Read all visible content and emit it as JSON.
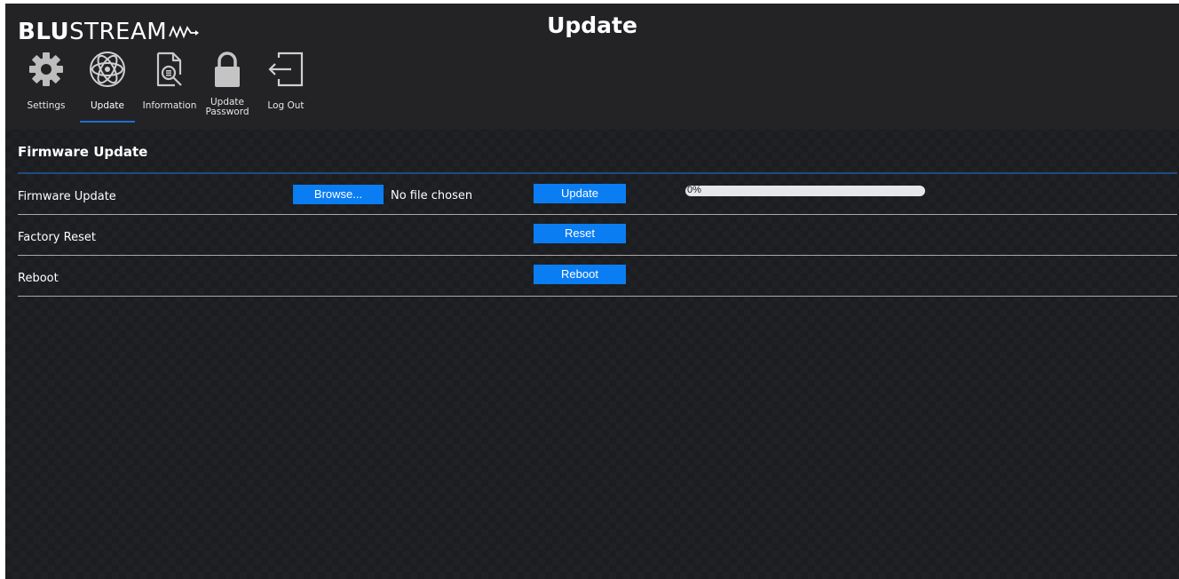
{
  "brand": {
    "bold_part": "BLU",
    "light_part": "STREAM"
  },
  "page_title": "Update",
  "nav": {
    "items": [
      {
        "label": "Settings",
        "icon": "gear-icon"
      },
      {
        "label": "Update",
        "icon": "atom-icon",
        "active": true
      },
      {
        "label": "Information",
        "icon": "document-search-icon"
      },
      {
        "label": "Update\nPassword",
        "icon": "lock-icon"
      },
      {
        "label": "Log Out",
        "icon": "logout-icon"
      }
    ]
  },
  "section": {
    "title": "Firmware Update"
  },
  "rows": {
    "firmware": {
      "label": "Firmware Update",
      "browse_label": "Browse...",
      "file_status": "No file chosen",
      "update_label": "Update",
      "progress_text": "0%",
      "progress_value": 0
    },
    "factory_reset": {
      "label": "Factory Reset",
      "button_label": "Reset"
    },
    "reboot": {
      "label": "Reboot",
      "button_label": "Reboot"
    }
  },
  "colors": {
    "background": "#1c1d20",
    "header": "#232326",
    "accent": "#0a7df2",
    "section_rule": "#1f4d7f"
  }
}
